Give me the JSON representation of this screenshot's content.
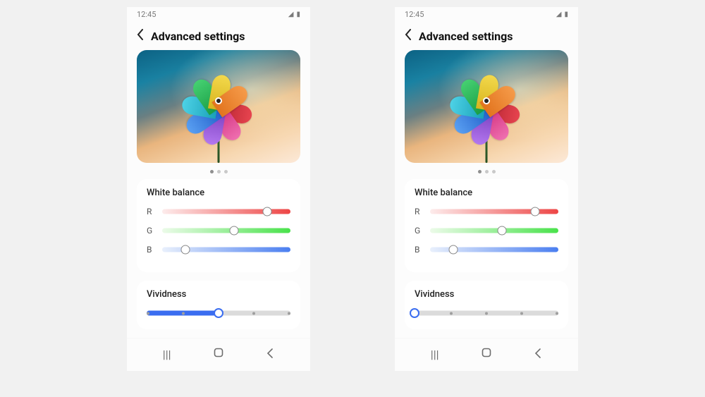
{
  "screens": [
    {
      "status": {
        "time": "12:45"
      },
      "header": {
        "title": "Advanced settings"
      },
      "pager": {
        "total": 3,
        "active": 0
      },
      "white_balance": {
        "title": "White balance",
        "channels": [
          {
            "label": "R",
            "value_pct": 82
          },
          {
            "label": "G",
            "value_pct": 56
          },
          {
            "label": "B",
            "value_pct": 18
          }
        ]
      },
      "vividness": {
        "title": "Vividness",
        "ticks": 5,
        "value_pct": 50,
        "accent": "#3a6df0"
      }
    },
    {
      "status": {
        "time": "12:45"
      },
      "header": {
        "title": "Advanced settings"
      },
      "pager": {
        "total": 3,
        "active": 0
      },
      "white_balance": {
        "title": "White balance",
        "channels": [
          {
            "label": "R",
            "value_pct": 82
          },
          {
            "label": "G",
            "value_pct": 56
          },
          {
            "label": "B",
            "value_pct": 18
          }
        ]
      },
      "vividness": {
        "title": "Vividness",
        "ticks": 5,
        "value_pct": 0,
        "accent": "#3a6df0"
      }
    }
  ]
}
